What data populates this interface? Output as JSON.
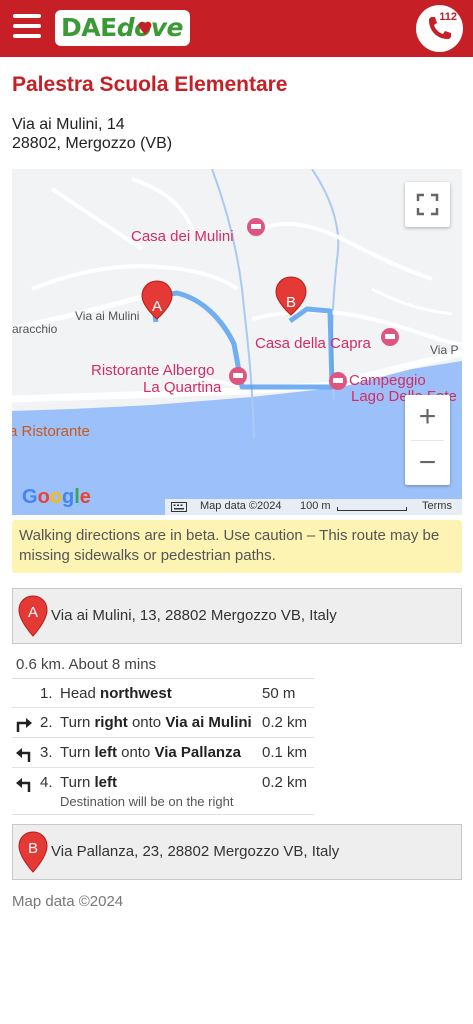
{
  "header": {
    "logo_dae": "DAE",
    "logo_dove": "dove",
    "call_number": "112",
    "brand_color": "#c62026",
    "logo_color": "#3a9a35"
  },
  "place": {
    "title": "Palestra Scuola Elementare",
    "address_line1": "Via ai Mulini, 14",
    "address_line2": "28802, Mergozzo (VB)"
  },
  "map": {
    "labels": {
      "poi_casa_mulini": "Casa dei Mulini",
      "poi_casa_capra": "Casa della Capra",
      "poi_ristorante_1": "Ristorante Albergo",
      "poi_ristorante_2": "La Quartina",
      "poi_campeggio_1": "Campeggio",
      "poi_campeggio_2": "Lago Delle Fate",
      "poi_ristorante_left": "a Ristorante",
      "road_bracchio": "aracchio",
      "road_mulini": "Via ai Mulini",
      "road_via_p": "Via P"
    },
    "marker_a": "A",
    "marker_b": "B",
    "attribution": {
      "map_data": "Map data ©2024",
      "scale": "100 m",
      "terms": "Terms"
    },
    "google_logo": [
      "G",
      "o",
      "o",
      "g",
      "l",
      "e"
    ],
    "zoom_in": "+",
    "zoom_out": "−",
    "icons": [
      "fullscreen-icon",
      "keyboard-icon",
      "hotel-icon"
    ]
  },
  "warning": "Walking directions are in beta. Use caution – This route may be missing sidewalks or pedestrian paths.",
  "origin": {
    "letter": "A",
    "address": "Via ai Mulini, 13, 28802 Mergozzo VB, Italy"
  },
  "summary": "0.6 km. About 8 mins",
  "steps": [
    {
      "num": "1.",
      "pre": "Head ",
      "bold1": "northwest",
      "mid": "",
      "bold2": "",
      "dist": "50 m",
      "note": "",
      "icon": ""
    },
    {
      "num": "2.",
      "pre": "Turn ",
      "bold1": "right",
      "mid": " onto ",
      "bold2": "Via ai Mulini",
      "dist": "0.2 km",
      "note": "",
      "icon": "turn-right-icon"
    },
    {
      "num": "3.",
      "pre": "Turn ",
      "bold1": "left",
      "mid": " onto ",
      "bold2": "Via Pallanza",
      "dist": "0.1 km",
      "note": "",
      "icon": "turn-left-icon"
    },
    {
      "num": "4.",
      "pre": "Turn ",
      "bold1": "left",
      "mid": "",
      "bold2": "",
      "dist": "0.2 km",
      "note": "Destination will be on the right",
      "icon": "turn-left-icon"
    }
  ],
  "destination": {
    "letter": "B",
    "address": "Via Pallanza, 23, 28802 Mergozzo VB, Italy"
  },
  "footer_note": "Map data ©2024"
}
